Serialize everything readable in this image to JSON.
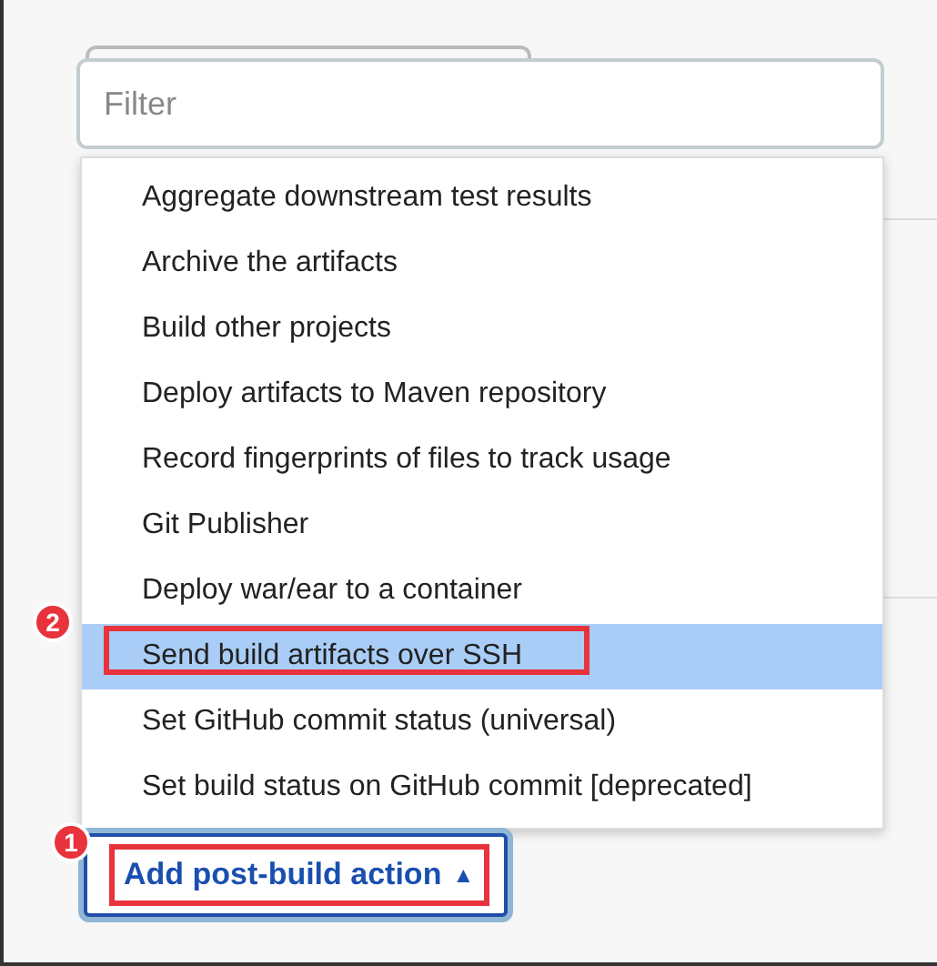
{
  "filter": {
    "placeholder": "Filter"
  },
  "menu": {
    "items": [
      {
        "label": "Aggregate downstream test results",
        "selected": false
      },
      {
        "label": "Archive the artifacts",
        "selected": false
      },
      {
        "label": "Build other projects",
        "selected": false
      },
      {
        "label": "Deploy artifacts to Maven repository",
        "selected": false
      },
      {
        "label": "Record fingerprints of files to track usage",
        "selected": false
      },
      {
        "label": "Git Publisher",
        "selected": false
      },
      {
        "label": "Deploy war/ear to a container",
        "selected": false
      },
      {
        "label": "Send build artifacts over SSH",
        "selected": true,
        "annotation": "2"
      },
      {
        "label": "Set GitHub commit status (universal)",
        "selected": false
      },
      {
        "label": "Set build status on GitHub commit [deprecated]",
        "selected": false
      }
    ]
  },
  "button": {
    "label": "Add post-build action",
    "caret": "▲",
    "focused": true,
    "annotation": "1"
  }
}
